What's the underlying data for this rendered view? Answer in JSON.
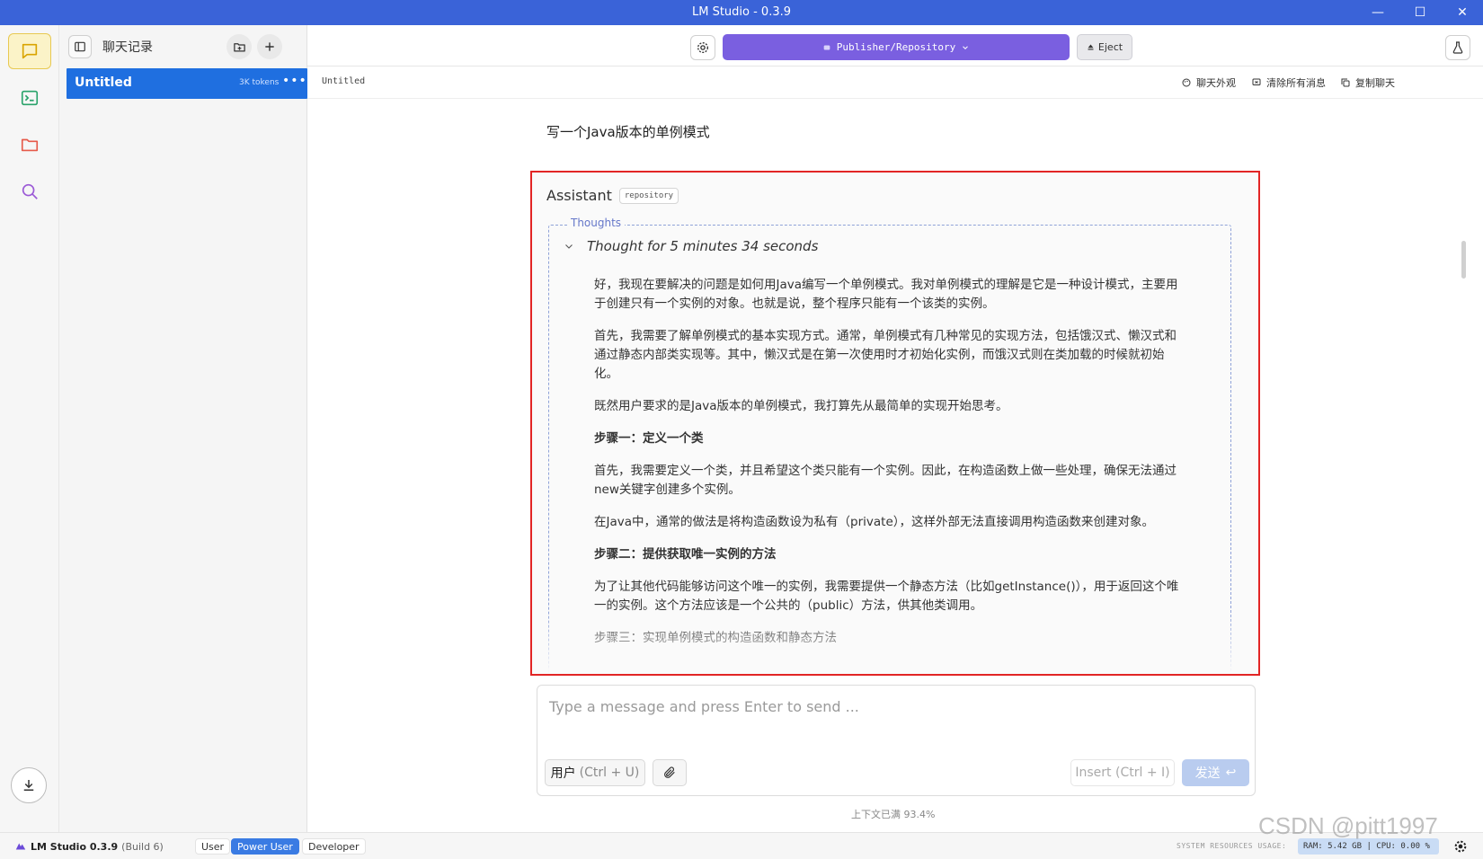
{
  "window": {
    "title": "LM Studio - 0.3.9",
    "minimize": "—",
    "maximize": "☐",
    "close": "✕"
  },
  "rail": {
    "items": [
      {
        "icon": "chat-icon",
        "active": true
      },
      {
        "icon": "terminal-icon",
        "active": false
      },
      {
        "icon": "folder-icon",
        "active": false
      },
      {
        "icon": "search-icon",
        "active": false
      }
    ],
    "download_icon": "download-icon"
  },
  "sidebar": {
    "title": "聊天记录",
    "chats": [
      {
        "name": "Untitled",
        "tokens": "3K tokens",
        "more": "•••"
      }
    ]
  },
  "toolbar": {
    "model_label": "Publisher/Repository",
    "eject_label": "Eject"
  },
  "subheader": {
    "crumb": "Untitled",
    "actions": [
      {
        "label": "聊天外观",
        "icon": "palette-icon"
      },
      {
        "label": "清除所有消息",
        "icon": "clear-icon"
      },
      {
        "label": "复制聊天",
        "icon": "copy-icon"
      }
    ]
  },
  "conversation": {
    "user_message": "写一个Java版本的单例模式",
    "assistant": {
      "name": "Assistant",
      "badge": "repository",
      "thoughts_legend": "Thoughts",
      "thought_summary": "Thought for 5 minutes 34 seconds",
      "paragraphs": [
        {
          "text": "好，我现在要解决的问题是如何用Java编写一个单例模式。我对单例模式的理解是它是一种设计模式，主要用于创建只有一个实例的对象。也就是说，整个程序只能有一个该类的实例。",
          "step": false
        },
        {
          "text": "首先，我需要了解单例模式的基本实现方式。通常，单例模式有几种常见的实现方法，包括饿汉式、懒汉式和通过静态内部类实现等。其中，懒汉式是在第一次使用时才初始化实例，而饿汉式则在类加载的时候就初始化。",
          "step": false
        },
        {
          "text": "既然用户要求的是Java版本的单例模式，我打算先从最简单的实现开始思考。",
          "step": false
        },
        {
          "text": "步骤一：定义一个类",
          "step": true
        },
        {
          "text": "首先，我需要定义一个类，并且希望这个类只能有一个实例。因此，在构造函数上做一些处理，确保无法通过new关键字创建多个实例。",
          "step": false
        },
        {
          "text": "在Java中，通常的做法是将构造函数设为私有（private），这样外部无法直接调用构造函数来创建对象。",
          "step": false
        },
        {
          "text": "步骤二：提供获取唯一实例的方法",
          "step": true
        },
        {
          "text": "为了让其他代码能够访问这个唯一的实例，我需要提供一个静态方法（比如getInstance()），用于返回这个唯一的实例。这个方法应该是一个公共的（public）方法，供其他类调用。",
          "step": false
        },
        {
          "text": "步骤三：实现单例模式的构造函数和静态方法",
          "step": false
        }
      ]
    }
  },
  "composer": {
    "placeholder": "Type a message and press Enter to send ...",
    "role_label": "用户",
    "role_hint": "(Ctrl + U)",
    "insert_label": "Insert (Ctrl + I)",
    "send_label": "发送",
    "send_icon": "↩",
    "context_status": "上下文已满 93.4%"
  },
  "statusbar": {
    "app_name": "LM Studio 0.3.9",
    "build": "(Build 6)",
    "modes": [
      "User",
      "Power User",
      "Developer"
    ],
    "active_mode": "Power User",
    "system_resources_label": "SYSTEM RESOURCES USAGE:",
    "resources": "RAM: 5.42 GB | CPU: 0.00 %"
  },
  "watermark": "CSDN @pitt1997",
  "colors": {
    "titlebar": "#3a63d8",
    "model_pill": "#7a5fe0",
    "selected_chat": "#1f6fe0",
    "highlight_border": "#e22525",
    "active_mode": "#3a7be3"
  }
}
